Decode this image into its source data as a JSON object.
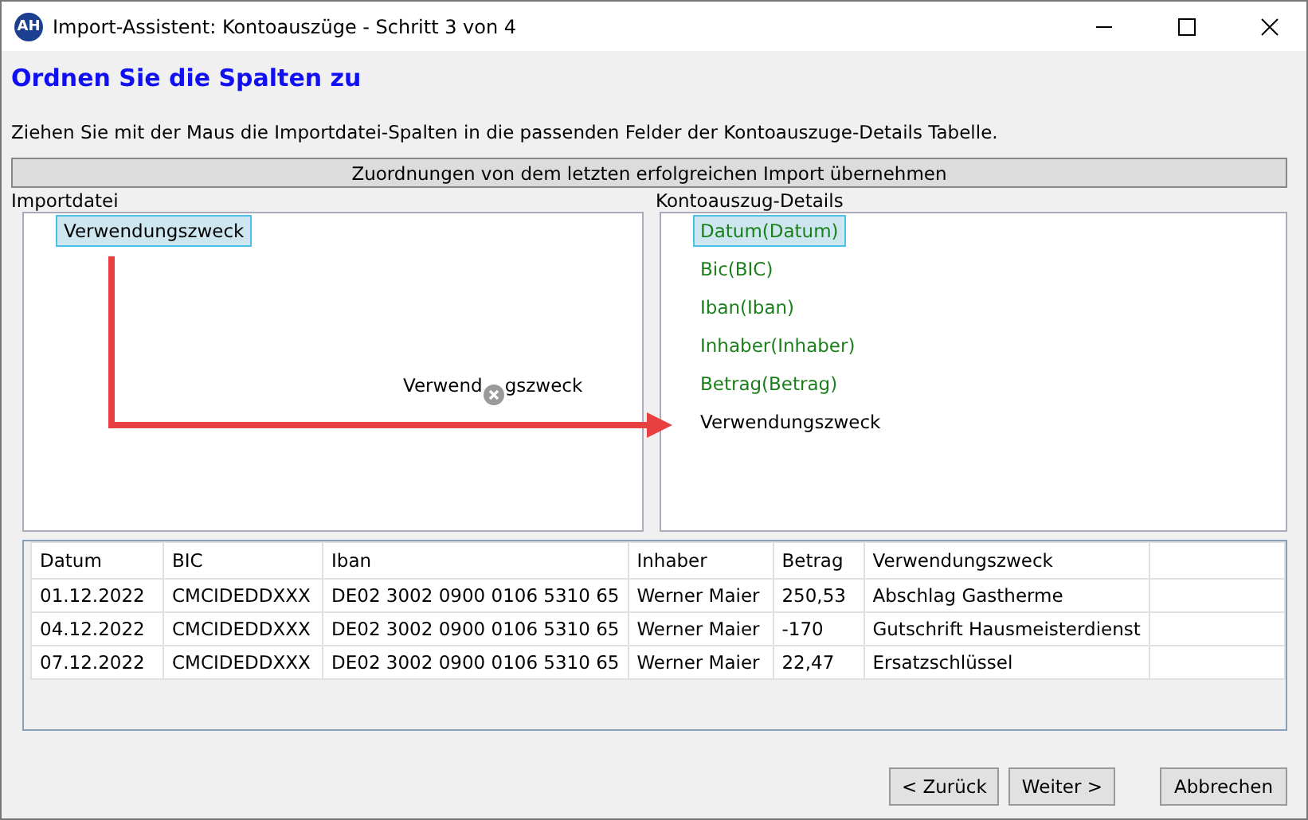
{
  "window": {
    "title": "Import-Assistent: Kontoauszüge - Schritt 3 von 4",
    "app_icon": "AH"
  },
  "heading": "Ordnen Sie die Spalten zu",
  "description": "Ziehen Sie mit der Maus die Importdatei-Spalten in die passenden Felder der Kontoauszuge-Details Tabelle.",
  "reuse_button": "Zuordnungen von dem letzten erfolgreichen Import übernehmen",
  "import_file": {
    "label": "Importdatei",
    "items": [
      {
        "label": "Verwendungszweck",
        "selected": true
      }
    ],
    "drag_ghost": [
      "Verwend",
      "gszweck"
    ]
  },
  "statement_details": {
    "label": "Kontoauszug-Details",
    "items": [
      {
        "label": "Datum(Datum)",
        "mapped": true,
        "selected": true
      },
      {
        "label": "Bic(BIC)",
        "mapped": true,
        "selected": false
      },
      {
        "label": "Iban(Iban)",
        "mapped": true,
        "selected": false
      },
      {
        "label": "Inhaber(Inhaber)",
        "mapped": true,
        "selected": false
      },
      {
        "label": "Betrag(Betrag)",
        "mapped": true,
        "selected": false
      },
      {
        "label": "Verwendungszweck",
        "mapped": false,
        "selected": false
      }
    ]
  },
  "table": {
    "columns": [
      "Datum",
      "BIC",
      "Iban",
      "Inhaber",
      "Betrag",
      "Verwendungszweck"
    ],
    "rows": [
      [
        "01.12.2022",
        "CMCIDEDDXXX",
        "DE02 3002 0900 0106 5310 65",
        "Werner Maier",
        "250,53",
        "Abschlag Gastherme"
      ],
      [
        "04.12.2022",
        "CMCIDEDDXXX",
        "DE02 3002 0900 0106 5310 65",
        "Werner Maier",
        "-170",
        "Gutschrift Hausmeisterdienst"
      ],
      [
        "07.12.2022",
        "CMCIDEDDXXX",
        "DE02 3002 0900 0106 5310 65",
        "Werner Maier",
        "22,47",
        "Ersatzschlüssel"
      ]
    ]
  },
  "buttons": [
    "< Zurück",
    "Weiter >",
    "Abbrechen"
  ]
}
